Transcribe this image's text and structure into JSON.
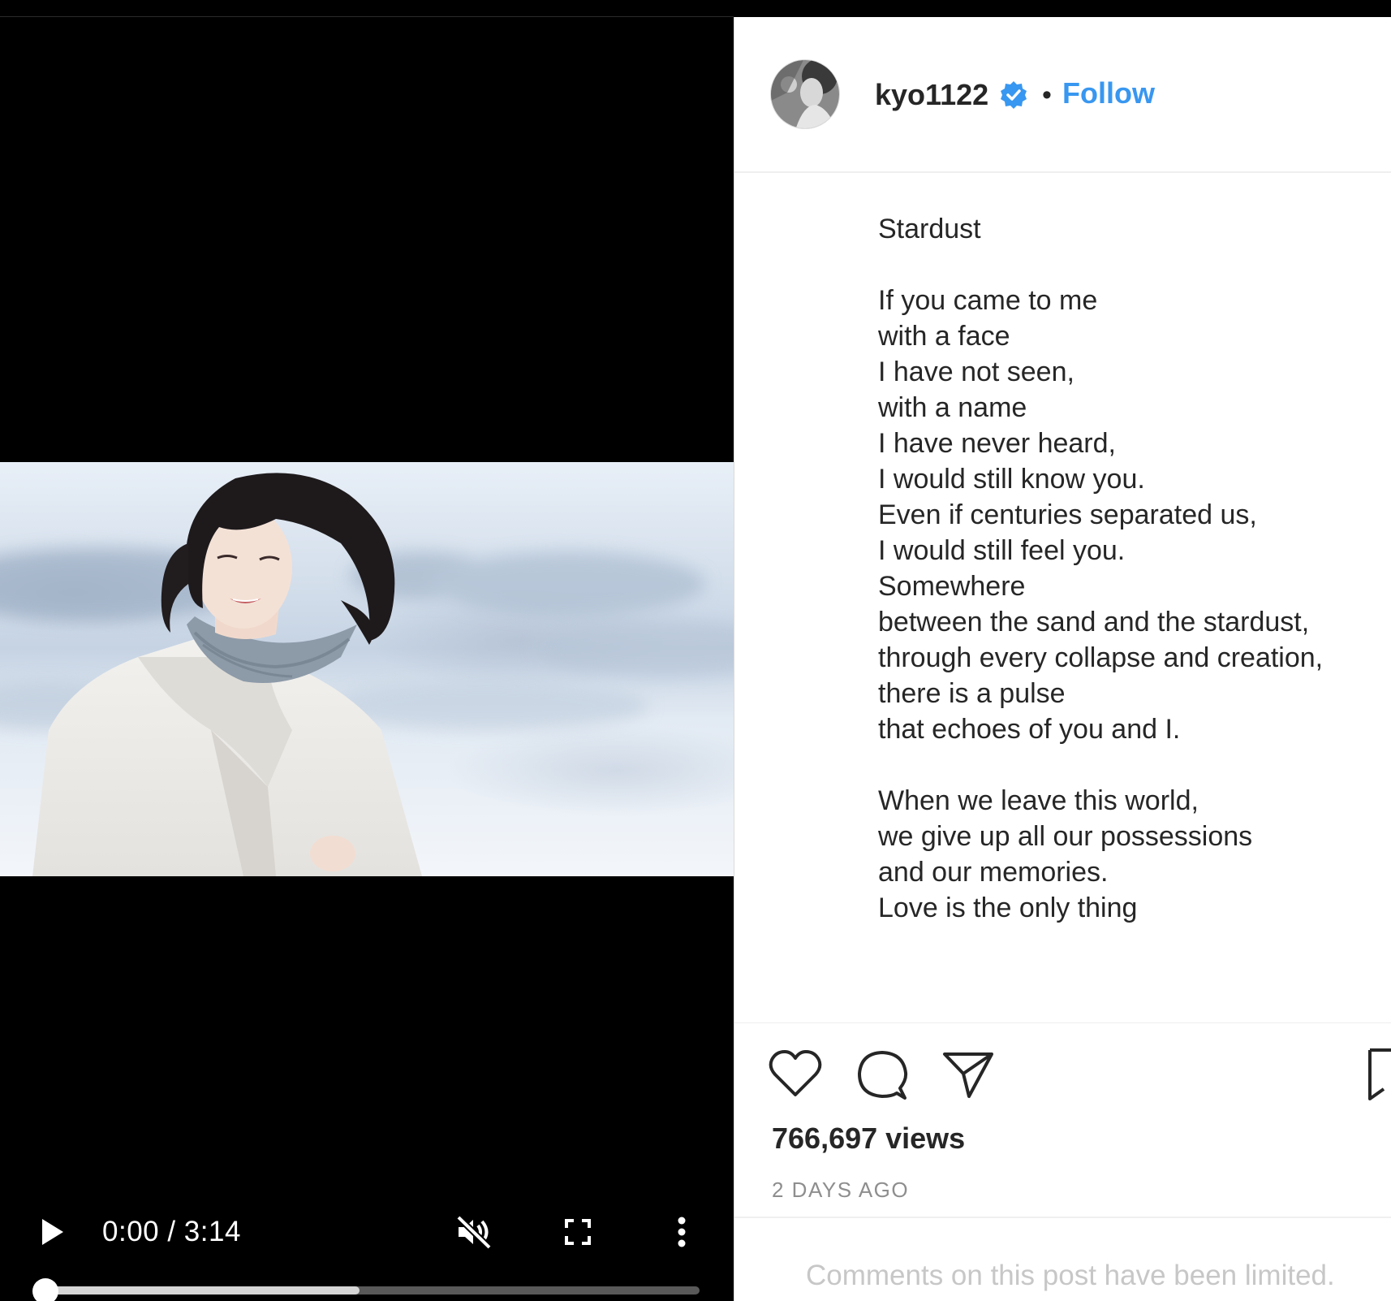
{
  "video": {
    "time_display": "0:00 / 3:14",
    "current_time": "0:00",
    "duration": "3:14",
    "buffered_fraction": 0.48,
    "muted": true,
    "playing": false
  },
  "post": {
    "username": "kyo1122",
    "verified": true,
    "separator": "•",
    "follow_label": "Follow",
    "caption_lines": [
      "Stardust",
      "",
      "If you came to me",
      "with a face",
      "I have not seen,",
      "with a name",
      "I have never heard,",
      "I would still know you.",
      "Even if centuries separated us,",
      "I would still feel you.",
      "Somewhere",
      "between the sand and the stardust,",
      "through every collapse and creation,",
      "there is a pulse",
      "that echoes of you and I.",
      "",
      "When we leave this world,",
      "we give up all our possessions",
      "and our memories.",
      "Love is the only thing"
    ],
    "views": "766,697 views",
    "timestamp": "2 DAYS AGO",
    "comments_note": "Comments on this post have been limited."
  },
  "colors": {
    "follow_blue": "#3897f0",
    "verified_blue": "#3897f0",
    "text_dark": "#262626",
    "text_muted": "#8e8e8e"
  },
  "icons": {
    "play": "play-icon",
    "mute": "muted-speaker-icon",
    "fullscreen": "fullscreen-icon",
    "more": "vertical-dots-icon",
    "verified": "verified-badge-icon",
    "like": "heart-icon",
    "comment": "speech-bubble-icon",
    "share": "paper-plane-icon",
    "save": "bookmark-icon"
  }
}
